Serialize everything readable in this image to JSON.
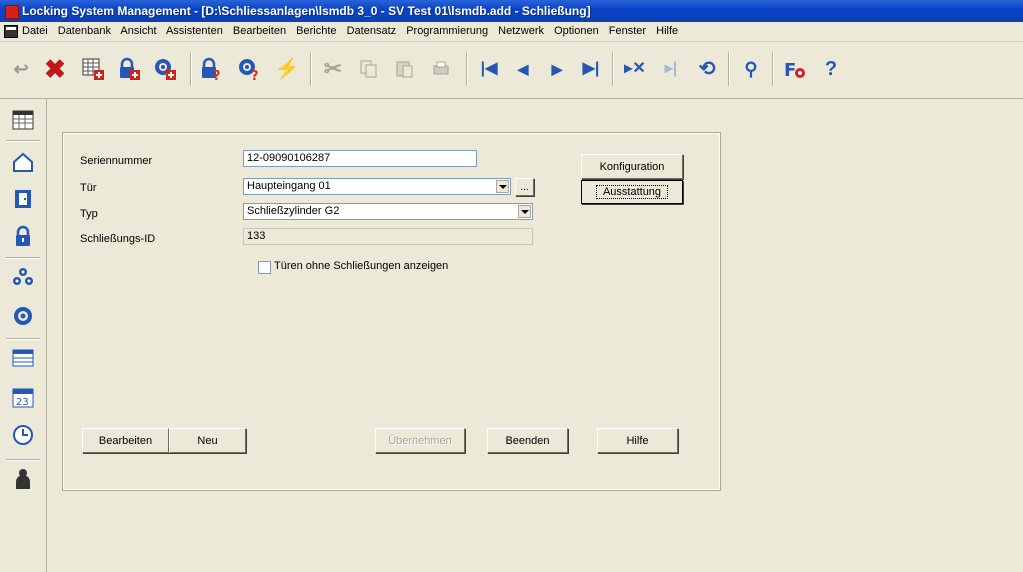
{
  "window": {
    "title": "Locking System Management - [D:\\Schliessanlagen\\lsmdb 3_0 - SV Test 01\\lsmdb.add - Schließung]"
  },
  "menu": [
    "Datei",
    "Datenbank",
    "Ansicht",
    "Assistenten",
    "Bearbeiten",
    "Berichte",
    "Datensatz",
    "Programmierung",
    "Netzwerk",
    "Optionen",
    "Fenster",
    "Hilfe"
  ],
  "form": {
    "serial_label": "Seriennummer",
    "serial_value": "12-09090106287",
    "door_label": "Tür",
    "door_value": "Haupteingang 01",
    "door_browse": "...",
    "type_label": "Typ",
    "type_value": "Schließzylinder G2",
    "lockid_label": "Schließungs-ID",
    "lockid_value": "133",
    "show_doors_label": "Türen ohne Schließungen anzeigen",
    "config_button": "Konfiguration",
    "equipment_button": "Ausstattung"
  },
  "footer": {
    "edit": "Bearbeiten",
    "new": "Neu",
    "apply": "Übernehmen",
    "close": "Beenden",
    "help": "Hilfe"
  },
  "colors": {
    "title_bar": "#0a45c9",
    "background": "#ece9d8",
    "red_accent": "#d8201a",
    "blue_accent": "#2458b8"
  }
}
